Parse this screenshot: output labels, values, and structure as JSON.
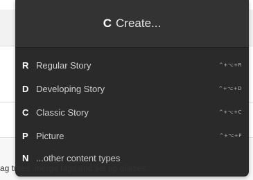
{
  "background": {
    "footer_text": "ag trees, merge tags and set up aliases."
  },
  "menu": {
    "header": {
      "key": "C",
      "label": "Create..."
    },
    "items": [
      {
        "key": "R",
        "label": "Regular Story",
        "shortcut": "^+⌥+R"
      },
      {
        "key": "D",
        "label": "Developing Story",
        "shortcut": "^+⌥+D"
      },
      {
        "key": "C",
        "label": "Classic Story",
        "shortcut": "^+⌥+C"
      },
      {
        "key": "P",
        "label": "Picture",
        "shortcut": "^+⌥+P"
      },
      {
        "key": "N",
        "label": "...other content types"
      }
    ]
  }
}
